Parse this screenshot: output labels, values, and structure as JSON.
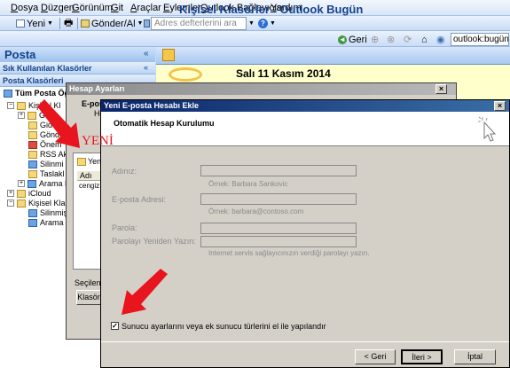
{
  "menubar": {
    "items": [
      "Dosya",
      "Düzgen",
      "Görünüm",
      "Git",
      "Araçlar",
      "Eylemler",
      "Outlook Bağlayıcısı",
      "Yardım"
    ]
  },
  "toolbar": {
    "new_label": "Yeni",
    "sendrecv_label": "Gönder/Al",
    "address_placeholder": "Adres defterlerini ara"
  },
  "webbar": {
    "back_label": "Geri",
    "url": "outlook:bugün"
  },
  "nav": {
    "title": "Posta",
    "favorites_section": "Sık Kullanılan Klasörler",
    "mail_section": "Posta Klasörleri",
    "all_mail": "Tüm Posta Öğe",
    "tree": [
      "Kişisel Kl",
      "Ge",
      "Gid",
      "Gönd",
      "Önem",
      "RSS Akı",
      "Silinmi",
      "Taslakl",
      "Arama K",
      "iCloud",
      "Kişisel Klasö",
      "Silinmiş",
      "Arama K"
    ]
  },
  "main": {
    "title": "Kişisel Klasörler - Outlook Bugün",
    "date": "Salı 11 Kasım 2014"
  },
  "hesap_dialog": {
    "title": "Hesap Ayarları",
    "tab_label": "E-posta",
    "sub_label": "He",
    "new_label": "Yen",
    "col_header": "Adı",
    "row_value": "cengiz",
    "selected_label": "Seçilen e",
    "folder_button": "Klasör"
  },
  "annotation": {
    "yeni_text": "YENİ",
    "arrow_color": "#e8141e"
  },
  "yeni_dialog": {
    "title": "Yeni E-posta Hesabı Ekle",
    "header_title": "Otomatik Hesap Kurulumu",
    "name_label": "Adınız:",
    "name_hint": "Örnek: Barbara Sankovic",
    "email_label": "E-posta Adresi:",
    "email_hint": "Örnek: barbara@contoso.com",
    "password_label": "Parola:",
    "password_repeat_label": "Parolayı Yeniden Yazın:",
    "password_hint": "Internet servis sağlayıcınızın verdiği parolayı yazın.",
    "checkbox_label": "Sunucu ayarlarını veya ek sunucu türlerini el ile yapılandır",
    "back_button": "< Geri",
    "next_button": "İleri >",
    "cancel_button": "İptal"
  }
}
